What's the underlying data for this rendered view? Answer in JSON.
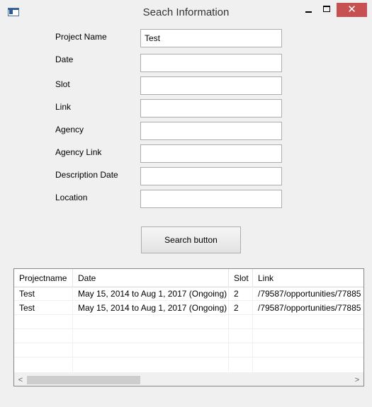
{
  "window": {
    "title": "Seach Information",
    "controls": {
      "minimize": "–",
      "maximize": "□",
      "close": "✕"
    }
  },
  "form": {
    "fields": [
      {
        "label": "Project Name",
        "value": "Test"
      },
      {
        "label": "Date",
        "value": ""
      },
      {
        "label": "Slot",
        "value": ""
      },
      {
        "label": "Link",
        "value": ""
      },
      {
        "label": "Agency",
        "value": ""
      },
      {
        "label": "Agency Link",
        "value": ""
      },
      {
        "label": "Description Date",
        "value": ""
      },
      {
        "label": "Location",
        "value": ""
      }
    ],
    "search_button": "Search button"
  },
  "grid": {
    "columns": [
      "Projectname",
      "Date",
      "Slot",
      "Link"
    ],
    "rows": [
      [
        "Test",
        "May 15, 2014 to Aug  1, 2017 (Ongoing)",
        "2",
        "/79587/opportunities/77885"
      ],
      [
        "Test",
        "May 15, 2014 to Aug  1, 2017 (Ongoing)",
        "2",
        "/79587/opportunities/77885"
      ]
    ],
    "scroll_left": "<",
    "scroll_right": ">"
  },
  "colors": {
    "close_button": "#c75050",
    "window_bg": "#f0f0f0"
  }
}
